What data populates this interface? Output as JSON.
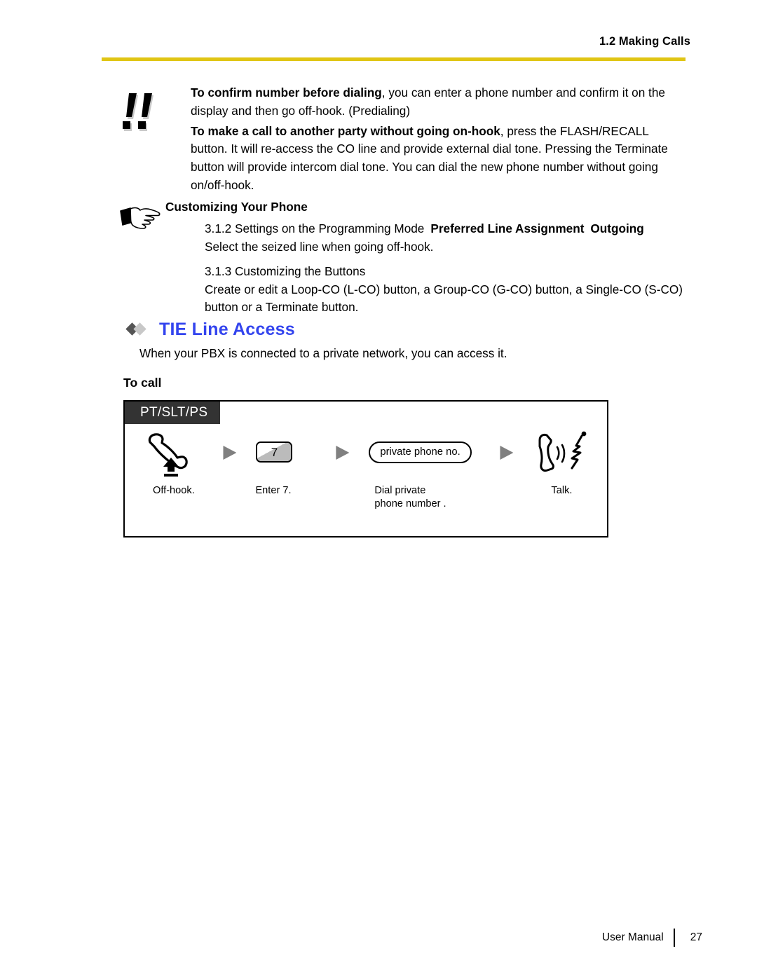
{
  "header": {
    "section_label": "1.2 Making Calls",
    "rule_color": "#e0c514"
  },
  "note": {
    "icon": "double-exclamation-icon",
    "paragraphs": [
      {
        "bold_lead": "To confirm number before dialing",
        "rest": ", you can enter a phone number and confirm it on the display and then go off-hook. (Predialing)"
      },
      {
        "bold_lead": "To make a call to another party without going on-hook",
        "rest": ", press the FLASH/RECALL button. It will re-access the CO line and provide external dial tone. Pressing the Terminate button will provide intercom dial tone. You can dial the new phone number without going on/off-hook."
      }
    ]
  },
  "customizing": {
    "icon": "pointing-hand-icon",
    "title": "Customizing Your Phone",
    "entries": [
      {
        "path_plain": "3.1.2 Settings on the Programming Mode",
        "path_bold_1": "Preferred Line Assignment",
        "path_bold_2": "Outgoing",
        "description": "Select the seized line when going off-hook."
      },
      {
        "path_plain": "3.1.3 Customizing the Buttons",
        "description": "Create or edit a Loop-CO (L-CO) button, a Group-CO (G-CO) button, a Single-CO (S-CO) button or a Terminate button."
      }
    ]
  },
  "section": {
    "title": "TIE Line Access",
    "title_color": "#3344ee",
    "bullet_colors": [
      "#555555",
      "#c8c8c8"
    ],
    "description": "When your PBX is connected to a private network, you can access it.",
    "subheading": "To call"
  },
  "procedure": {
    "tab_label": "PT/SLT/PS",
    "steps": [
      {
        "icon": "offhook-handset-icon",
        "label": "Off-hook."
      },
      {
        "icon": "keypad-key-icon",
        "key": "7",
        "label": "Enter 7."
      },
      {
        "icon": "input-pill",
        "pill_text": "private phone no.",
        "label": "Dial private\nphone number  ."
      },
      {
        "icon": "talk-handset-icon",
        "label": "Talk."
      }
    ],
    "separator_icon": "right-triangle-arrow-icon"
  },
  "footer": {
    "label": "User Manual",
    "page": "27"
  }
}
